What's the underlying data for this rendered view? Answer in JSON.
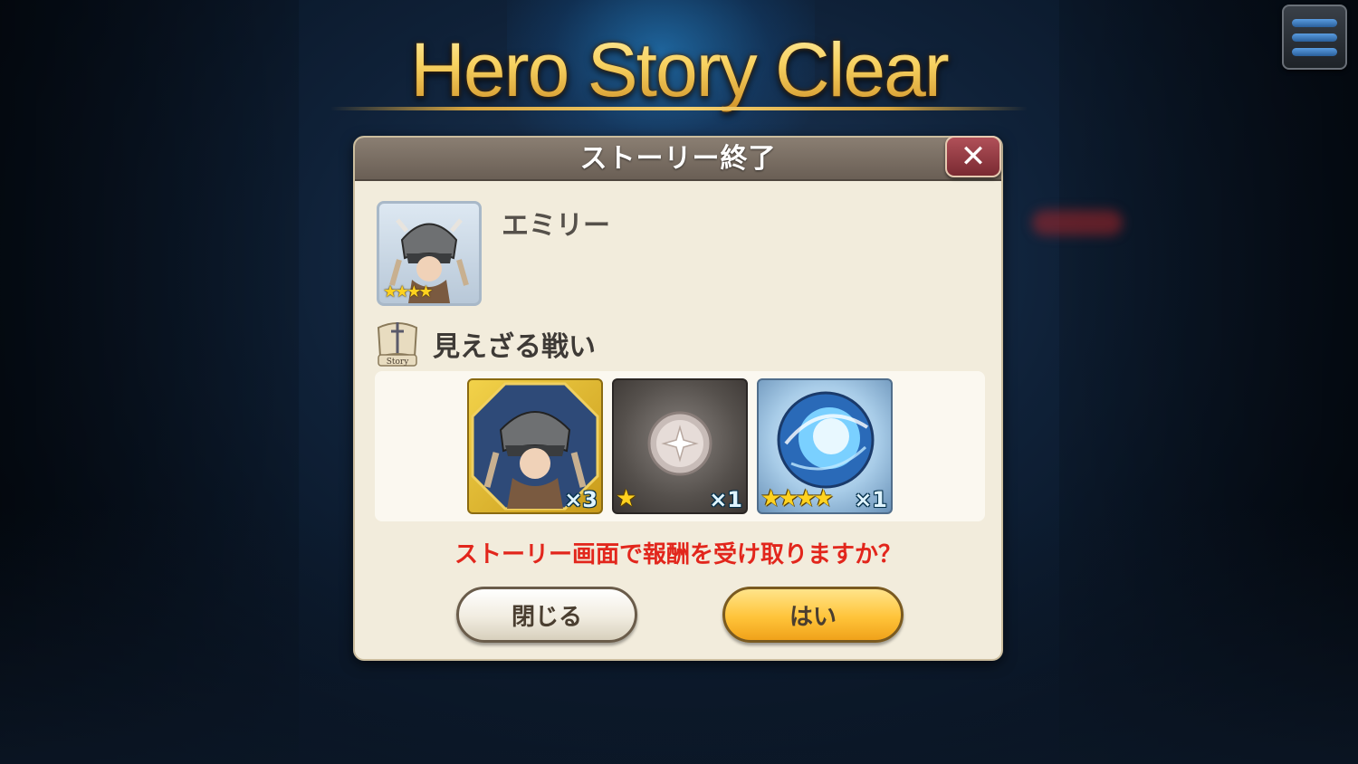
{
  "title": "Hero Story Clear",
  "dialog": {
    "title": "ストーリー終了",
    "close_icon": "close-icon"
  },
  "hero": {
    "name": "エミリー",
    "stars": "★★★★"
  },
  "story": {
    "icon_label": "Story",
    "name": "見えざる戦い"
  },
  "rewards": [
    {
      "item": "hero-shard",
      "count": "×3",
      "stars": ""
    },
    {
      "item": "silver-medal",
      "count": "×1",
      "stars": "★"
    },
    {
      "item": "blue-orb",
      "count": "×1",
      "stars": "★★★★"
    }
  ],
  "prompt": "ストーリー画面で報酬を受け取りますか？",
  "buttons": {
    "close": "閉じる",
    "yes": "はい"
  },
  "colors": {
    "title_gold": "#f7d160",
    "prompt_red": "#e2261c",
    "yes_button": "#ffc43a"
  }
}
